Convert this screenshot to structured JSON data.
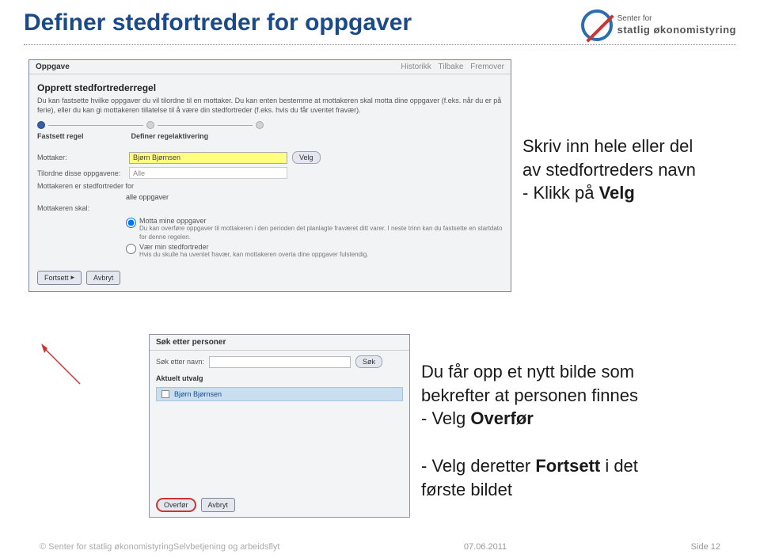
{
  "header": {
    "title": "Definer stedfortreder for oppgaver",
    "logo": {
      "line1": "Senter for",
      "line2": "statlig økonomistyring"
    }
  },
  "panel": {
    "top_left": "Oppgave",
    "top_right": [
      "Historikk",
      "Tilbake",
      "Fremover"
    ],
    "heading": "Opprett stedfortrederregel",
    "desc": "Du kan fastsette hvilke oppgaver du vil tilordne til en mottaker. Du kan enten bestemme at mottakeren skal motta dine oppgaver (f.eks. når du er på ferie), eller du kan gi mottakeren tillatelse til å være din stedfortreder (f.eks. hvis du får uventet fravær).",
    "steps": [
      "1",
      "2",
      "3"
    ],
    "step_labels": [
      "Fastsett regel",
      "Definer regelaktivering"
    ],
    "mottaker_label": "Mottaker:",
    "mottaker_value": "Bjørn Bjørnsen",
    "velg_btn": "Velg",
    "tilordne_label": "Tilordne disse oppgavene:",
    "tilordne_value": "Alle",
    "sf_label": "Mottakeren er stedfortreder for",
    "sf_value": "alle oppgaver",
    "skal_label": "Mottakeren skal:",
    "radios": {
      "r1": "Motta mine oppgaver",
      "r1_sub": "Du kan overføre oppgaver til mottakeren i den perioden det planlagte fraværet ditt varer. I neste trinn kan du fastsette en startdato for denne regelen.",
      "r2": "Vær min stedfortreder",
      "r2_sub": "Hvis du skulle ha uventet fravær, kan mottakeren overta dine oppgaver fulstendig."
    },
    "fortsett": "Fortsett",
    "avbryt": "Avbryt"
  },
  "subpanel": {
    "head": "Søk etter personer",
    "label": "Søk etter navn:",
    "sok": "Søk",
    "sub": "Aktuelt utvalg",
    "result": "Bjørn Bjørnsen",
    "overfor": "Overfør",
    "avbryt": "Avbryt"
  },
  "annot": {
    "a1_l1": "Skriv inn hele eller del",
    "a1_l2": "av stedfortreders navn",
    "a1_l3_pre": "- Klikk på ",
    "a1_l3_b": "Velg",
    "a2_l1": "Du får opp et nytt bilde som",
    "a2_l2": "bekrefter at personen finnes",
    "a2_l3_pre": "- Velg ",
    "a2_l3_b": "Overfør",
    "a3_l1_pre": "- Velg deretter ",
    "a3_l1_b": "Fortsett",
    "a3_l1_post": " i det",
    "a3_l2": "første bildet"
  },
  "footer": {
    "left": "© Senter for statlig økonomistyringSelvbetjening og arbeidsflyt",
    "date": "07.06.2011",
    "page": "Side 12"
  }
}
